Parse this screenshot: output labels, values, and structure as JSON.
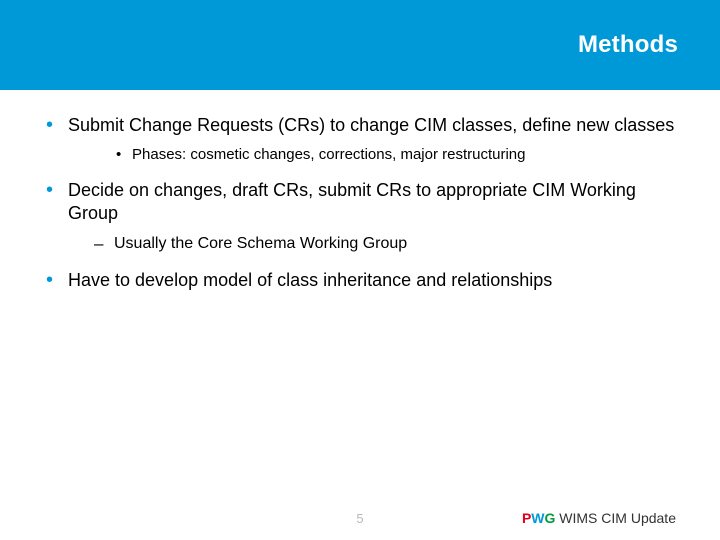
{
  "header": {
    "title": "Methods"
  },
  "content": {
    "items": [
      {
        "text": "Submit Change Requests (CRs) to change CIM classes, define new classes",
        "sub": [
          {
            "type": "bullet",
            "text": "Phases: cosmetic changes, corrections, major restructuring"
          }
        ]
      },
      {
        "text": "Decide on changes, draft CRs, submit CRs to appropriate CIM Working Group",
        "sub": [
          {
            "type": "dash",
            "text": "Usually the Core Schema Working Group"
          }
        ]
      },
      {
        "text": "Have to develop model of class inheritance and relationships",
        "sub": []
      }
    ]
  },
  "footer": {
    "page": "5",
    "brand": {
      "p": "P",
      "w": "W",
      "g": "G"
    },
    "label": " WIMS CIM Update"
  }
}
